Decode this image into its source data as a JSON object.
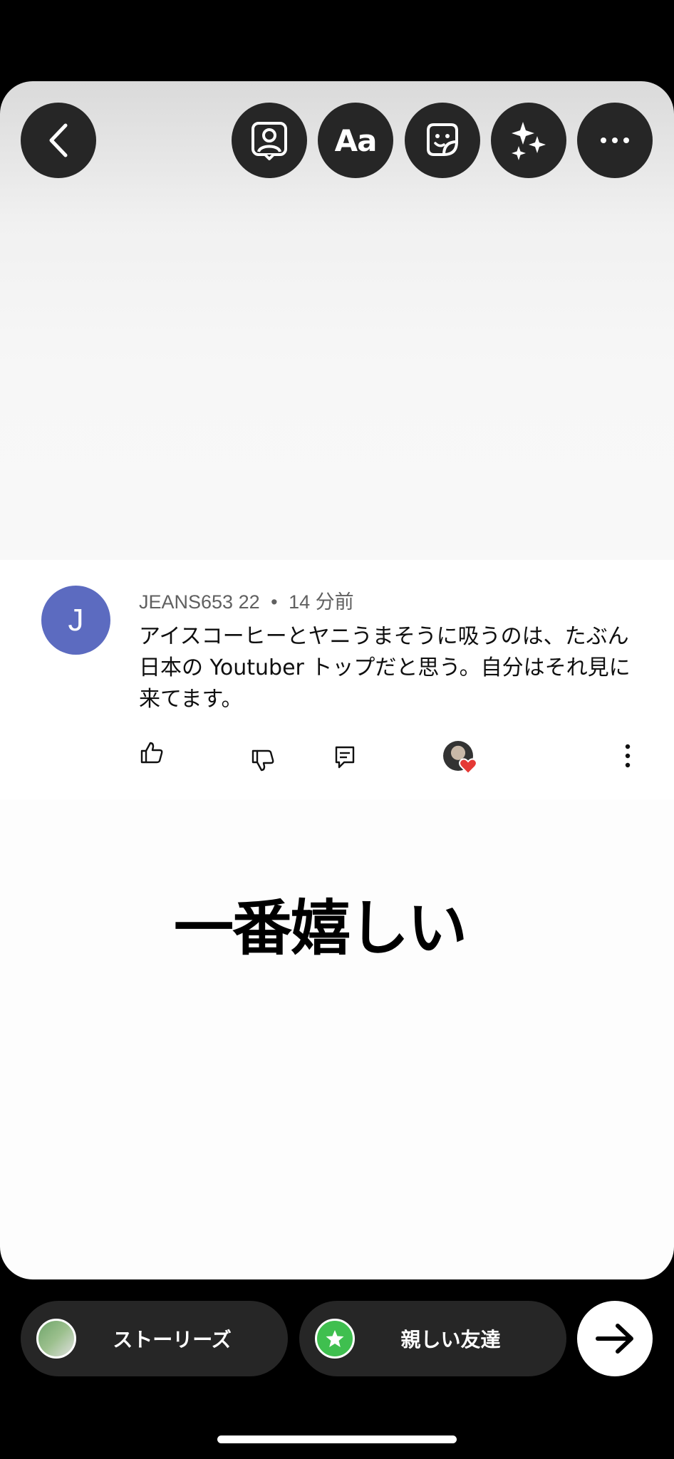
{
  "toolbar": {
    "back_icon": "chevron-left-icon",
    "mention_icon": "person-frame-icon",
    "text_label": "Aa",
    "sticker_icon": "sticker-icon",
    "effects_icon": "sparkles-icon",
    "more_icon": "more-horizontal-icon"
  },
  "comment": {
    "avatar_letter": "J",
    "avatar_color": "#5c6bc0",
    "username": "JEANS653 22",
    "separator": "•",
    "time": "14 分前",
    "text": "アイスコーヒーとヤニうまそうに吸うのは、たぶん日本の Youtuber トップだと思う。自分はそれ見に来てます。"
  },
  "caption": "一番嬉しい",
  "share": {
    "story_label": "ストーリーズ",
    "close_friends_label": "親しい友達",
    "close_friends_color": "#3fbf4f"
  }
}
